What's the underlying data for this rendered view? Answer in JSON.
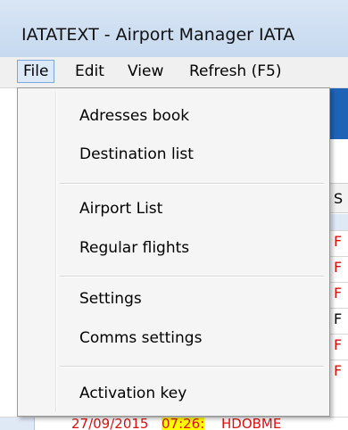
{
  "window": {
    "title": "IATATEXT - Airport Manager IATA"
  },
  "menubar": {
    "items": [
      {
        "label": "File",
        "active": true
      },
      {
        "label": "Edit"
      },
      {
        "label": "View"
      },
      {
        "label": "Refresh (F5)"
      }
    ]
  },
  "file_menu": {
    "groups": [
      [
        "Adresses book",
        "Destination list"
      ],
      [
        "Airport List",
        "Regular flights"
      ],
      [
        "Settings",
        "Comms settings"
      ],
      [
        "Activation key"
      ]
    ]
  },
  "background": {
    "header_cell": "S",
    "rows": [
      {
        "text": "F",
        "color": "#e01010"
      },
      {
        "text": "F",
        "color": "#e01010"
      },
      {
        "text": "F",
        "color": "#e01010"
      },
      {
        "text": "F",
        "color": "#000000"
      },
      {
        "text": "F",
        "color": "#e01010"
      },
      {
        "text": "F",
        "color": "#e01010"
      }
    ],
    "bottom_row": {
      "date": "27/09/2015",
      "time": "07:26:",
      "code": "HDOBME"
    }
  },
  "colors": {
    "accent_blue": "#1f63b7",
    "highlight_yellow": "#ffff00",
    "error_red": "#e01010"
  }
}
